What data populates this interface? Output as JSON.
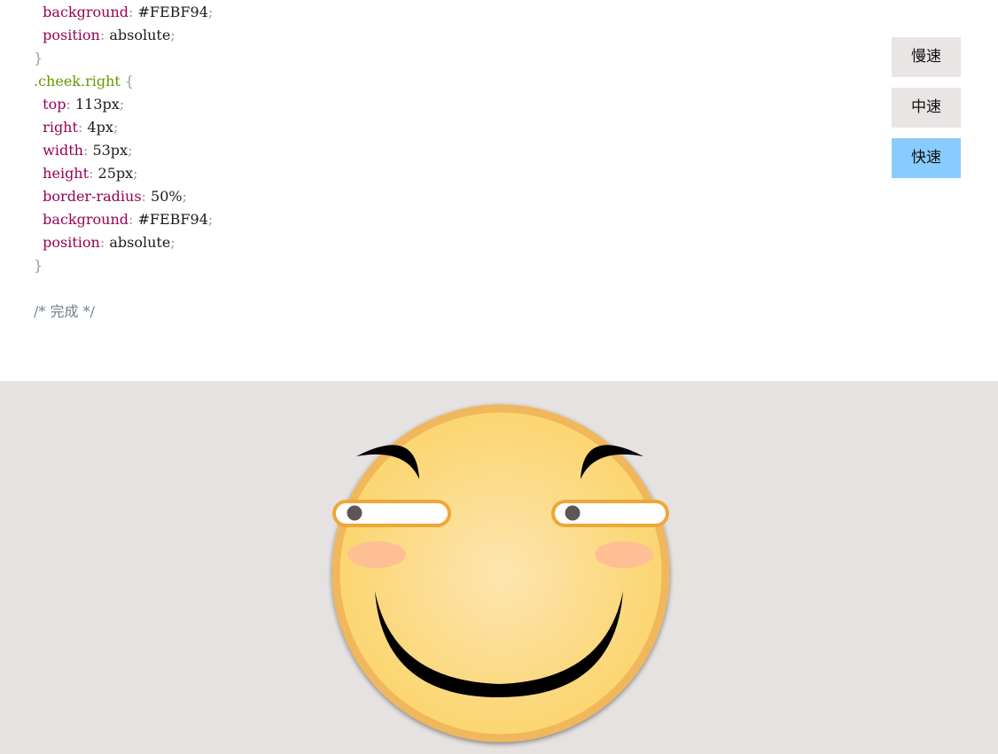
{
  "code": {
    "lines": [
      [
        {
          "t": "  ",
          "c": "indent"
        },
        {
          "t": "background",
          "c": "prop"
        },
        {
          "t": ":",
          "c": "punct"
        },
        {
          "t": " #FEBF94",
          "c": "value"
        },
        {
          "t": ";",
          "c": "punct"
        }
      ],
      [
        {
          "t": "  ",
          "c": "indent"
        },
        {
          "t": "position",
          "c": "prop"
        },
        {
          "t": ":",
          "c": "punct"
        },
        {
          "t": " absolute",
          "c": "value"
        },
        {
          "t": ";",
          "c": "punct"
        }
      ],
      [
        {
          "t": "}",
          "c": "punct"
        }
      ],
      [
        {
          "t": ".cheek.right",
          "c": "selector"
        },
        {
          "t": " {",
          "c": "punct"
        }
      ],
      [
        {
          "t": "  ",
          "c": "indent"
        },
        {
          "t": "top",
          "c": "prop"
        },
        {
          "t": ":",
          "c": "punct"
        },
        {
          "t": " 113px",
          "c": "value"
        },
        {
          "t": ";",
          "c": "punct"
        }
      ],
      [
        {
          "t": "  ",
          "c": "indent"
        },
        {
          "t": "right",
          "c": "prop"
        },
        {
          "t": ":",
          "c": "punct"
        },
        {
          "t": " 4px",
          "c": "value"
        },
        {
          "t": ";",
          "c": "punct"
        }
      ],
      [
        {
          "t": "  ",
          "c": "indent"
        },
        {
          "t": "width",
          "c": "prop"
        },
        {
          "t": ":",
          "c": "punct"
        },
        {
          "t": " 53px",
          "c": "value"
        },
        {
          "t": ";",
          "c": "punct"
        }
      ],
      [
        {
          "t": "  ",
          "c": "indent"
        },
        {
          "t": "height",
          "c": "prop"
        },
        {
          "t": ":",
          "c": "punct"
        },
        {
          "t": " 25px",
          "c": "value"
        },
        {
          "t": ";",
          "c": "punct"
        }
      ],
      [
        {
          "t": "  ",
          "c": "indent"
        },
        {
          "t": "border-radius",
          "c": "prop"
        },
        {
          "t": ":",
          "c": "punct"
        },
        {
          "t": " 50%",
          "c": "value"
        },
        {
          "t": ";",
          "c": "punct"
        }
      ],
      [
        {
          "t": "  ",
          "c": "indent"
        },
        {
          "t": "background",
          "c": "prop"
        },
        {
          "t": ":",
          "c": "punct"
        },
        {
          "t": " #FEBF94",
          "c": "value"
        },
        {
          "t": ";",
          "c": "punct"
        }
      ],
      [
        {
          "t": "  ",
          "c": "indent"
        },
        {
          "t": "position",
          "c": "prop"
        },
        {
          "t": ":",
          "c": "punct"
        },
        {
          "t": " absolute",
          "c": "value"
        },
        {
          "t": ";",
          "c": "punct"
        }
      ],
      [
        {
          "t": "}",
          "c": "punct"
        }
      ],
      [
        {
          "t": "",
          "c": "value"
        }
      ],
      [
        {
          "t": "/* 完成 */",
          "c": "comment"
        }
      ]
    ]
  },
  "controls": {
    "slow_label": "慢速",
    "medium_label": "中速",
    "fast_label": "快速",
    "active": "fast"
  },
  "colors": {
    "code_background": "#ffffff",
    "preview_background": "#e6e2e1",
    "button_background": "#e8e5e4",
    "button_active": "#88ccff",
    "selector": "#669900",
    "property": "#990055",
    "punctuation": "#999999",
    "comment": "#708090",
    "face_inner": "#fce5b0",
    "face_outer": "#fcd56f",
    "face_rim": "#f0b75c",
    "eye_outline": "#eea837",
    "eye_white": "#ffffff",
    "pupil": "#5f5556",
    "cheek": "#febf94",
    "feature": "#000000"
  }
}
